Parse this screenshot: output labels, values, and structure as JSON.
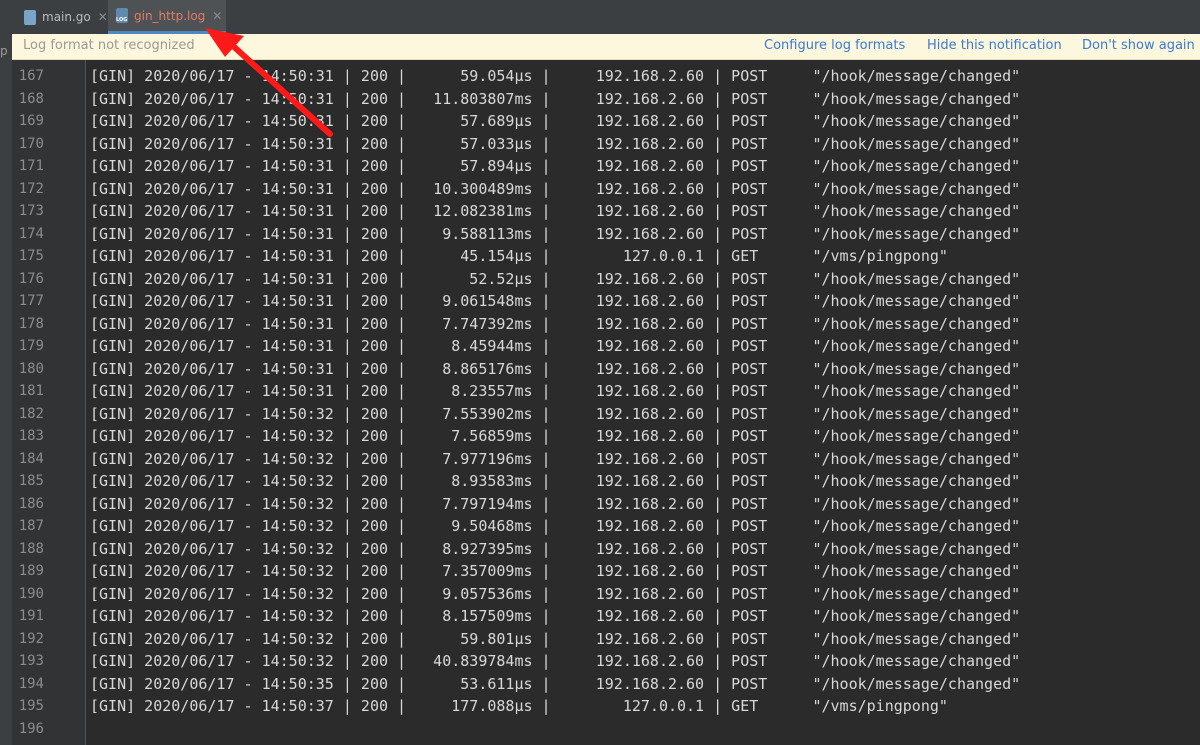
{
  "left_edge_fragment": "p",
  "tabs": [
    {
      "label": "main.go",
      "icon": "go-file-icon",
      "active": false
    },
    {
      "label": "gin_http.log",
      "icon": "log-file-icon",
      "active": true
    }
  ],
  "notification": {
    "message": "Log format not recognized",
    "links": [
      "Configure log formats",
      "Hide this notification",
      "Don't show again"
    ]
  },
  "log_lines": [
    {
      "n": "167",
      "text": "[GIN] 2020/06/17 - 14:50:31 | 200 |      59.054µs |     192.168.2.60 | POST     \"/hook/message/changed\""
    },
    {
      "n": "168",
      "text": "[GIN] 2020/06/17 - 14:50:31 | 200 |   11.803807ms |     192.168.2.60 | POST     \"/hook/message/changed\""
    },
    {
      "n": "169",
      "text": "[GIN] 2020/06/17 - 14:50:31 | 200 |      57.689µs |     192.168.2.60 | POST     \"/hook/message/changed\""
    },
    {
      "n": "170",
      "text": "[GIN] 2020/06/17 - 14:50:31 | 200 |      57.033µs |     192.168.2.60 | POST     \"/hook/message/changed\""
    },
    {
      "n": "171",
      "text": "[GIN] 2020/06/17 - 14:50:31 | 200 |      57.894µs |     192.168.2.60 | POST     \"/hook/message/changed\""
    },
    {
      "n": "172",
      "text": "[GIN] 2020/06/17 - 14:50:31 | 200 |   10.300489ms |     192.168.2.60 | POST     \"/hook/message/changed\""
    },
    {
      "n": "173",
      "text": "[GIN] 2020/06/17 - 14:50:31 | 200 |   12.082381ms |     192.168.2.60 | POST     \"/hook/message/changed\""
    },
    {
      "n": "174",
      "text": "[GIN] 2020/06/17 - 14:50:31 | 200 |    9.588113ms |     192.168.2.60 | POST     \"/hook/message/changed\""
    },
    {
      "n": "175",
      "text": "[GIN] 2020/06/17 - 14:50:31 | 200 |      45.154µs |        127.0.0.1 | GET      \"/vms/pingpong\""
    },
    {
      "n": "176",
      "text": "[GIN] 2020/06/17 - 14:50:31 | 200 |       52.52µs |     192.168.2.60 | POST     \"/hook/message/changed\""
    },
    {
      "n": "177",
      "text": "[GIN] 2020/06/17 - 14:50:31 | 200 |    9.061548ms |     192.168.2.60 | POST     \"/hook/message/changed\""
    },
    {
      "n": "178",
      "text": "[GIN] 2020/06/17 - 14:50:31 | 200 |    7.747392ms |     192.168.2.60 | POST     \"/hook/message/changed\""
    },
    {
      "n": "179",
      "text": "[GIN] 2020/06/17 - 14:50:31 | 200 |     8.45944ms |     192.168.2.60 | POST     \"/hook/message/changed\""
    },
    {
      "n": "180",
      "text": "[GIN] 2020/06/17 - 14:50:31 | 200 |    8.865176ms |     192.168.2.60 | POST     \"/hook/message/changed\""
    },
    {
      "n": "181",
      "text": "[GIN] 2020/06/17 - 14:50:31 | 200 |     8.23557ms |     192.168.2.60 | POST     \"/hook/message/changed\""
    },
    {
      "n": "182",
      "text": "[GIN] 2020/06/17 - 14:50:32 | 200 |    7.553902ms |     192.168.2.60 | POST     \"/hook/message/changed\""
    },
    {
      "n": "183",
      "text": "[GIN] 2020/06/17 - 14:50:32 | 200 |     7.56859ms |     192.168.2.60 | POST     \"/hook/message/changed\""
    },
    {
      "n": "184",
      "text": "[GIN] 2020/06/17 - 14:50:32 | 200 |    7.977196ms |     192.168.2.60 | POST     \"/hook/message/changed\""
    },
    {
      "n": "185",
      "text": "[GIN] 2020/06/17 - 14:50:32 | 200 |     8.93583ms |     192.168.2.60 | POST     \"/hook/message/changed\""
    },
    {
      "n": "186",
      "text": "[GIN] 2020/06/17 - 14:50:32 | 200 |    7.797194ms |     192.168.2.60 | POST     \"/hook/message/changed\""
    },
    {
      "n": "187",
      "text": "[GIN] 2020/06/17 - 14:50:32 | 200 |     9.50468ms |     192.168.2.60 | POST     \"/hook/message/changed\""
    },
    {
      "n": "188",
      "text": "[GIN] 2020/06/17 - 14:50:32 | 200 |    8.927395ms |     192.168.2.60 | POST     \"/hook/message/changed\""
    },
    {
      "n": "189",
      "text": "[GIN] 2020/06/17 - 14:50:32 | 200 |    7.357009ms |     192.168.2.60 | POST     \"/hook/message/changed\""
    },
    {
      "n": "190",
      "text": "[GIN] 2020/06/17 - 14:50:32 | 200 |    9.057536ms |     192.168.2.60 | POST     \"/hook/message/changed\""
    },
    {
      "n": "191",
      "text": "[GIN] 2020/06/17 - 14:50:32 | 200 |    8.157509ms |     192.168.2.60 | POST     \"/hook/message/changed\""
    },
    {
      "n": "192",
      "text": "[GIN] 2020/06/17 - 14:50:32 | 200 |      59.801µs |     192.168.2.60 | POST     \"/hook/message/changed\""
    },
    {
      "n": "193",
      "text": "[GIN] 2020/06/17 - 14:50:32 | 200 |   40.839784ms |     192.168.2.60 | POST     \"/hook/message/changed\""
    },
    {
      "n": "194",
      "text": "[GIN] 2020/06/17 - 14:50:35 | 200 |      53.611µs |     192.168.2.60 | POST     \"/hook/message/changed\""
    },
    {
      "n": "195",
      "text": "[GIN] 2020/06/17 - 14:50:37 | 200 |     177.088µs |        127.0.0.1 | GET      \"/vms/pingpong\""
    },
    {
      "n": "196",
      "text": ""
    }
  ],
  "colors": {
    "editor_bg": "#2b2b2b",
    "gutter_bg": "#313335",
    "notification_bg": "#fdf7dd",
    "link": "#3a7ad0",
    "active_tab_text": "#e07b6a",
    "arrow": "#ff1a1a"
  }
}
